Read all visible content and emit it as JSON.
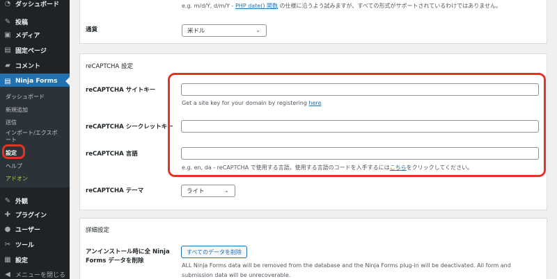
{
  "sidebar": {
    "items": [
      {
        "label": "ダッシュボード",
        "icon": "dashboard-icon",
        "glyph": "◔"
      },
      {
        "label": "投稿",
        "icon": "pin-icon",
        "glyph": "✎"
      },
      {
        "label": "メディア",
        "icon": "media-icon",
        "glyph": "▣"
      },
      {
        "label": "固定ページ",
        "icon": "page-icon",
        "glyph": "▤"
      },
      {
        "label": "コメント",
        "icon": "comment-icon",
        "glyph": "▰"
      },
      {
        "label": "Ninja Forms",
        "icon": "forms-icon",
        "glyph": "▤"
      },
      {
        "label": "外観",
        "icon": "appearance-icon",
        "glyph": "✎"
      },
      {
        "label": "プラグイン",
        "icon": "plugin-icon",
        "glyph": "✚"
      },
      {
        "label": "ユーザー",
        "icon": "user-icon",
        "glyph": "●"
      },
      {
        "label": "ツール",
        "icon": "tools-icon",
        "glyph": "✂"
      },
      {
        "label": "設定",
        "icon": "settings-icon",
        "glyph": "▦"
      },
      {
        "label": "メニューを閉じる",
        "icon": "collapse-icon",
        "glyph": "◀"
      }
    ],
    "submenu": [
      {
        "label": "ダッシュボード"
      },
      {
        "label": "新規追加"
      },
      {
        "label": "送信"
      },
      {
        "label": "インポート/エクスポ\nート"
      },
      {
        "label": "設定"
      },
      {
        "label": "ヘルプ"
      },
      {
        "label": "アドオン"
      }
    ]
  },
  "top_card": {
    "date_hint_pre": "e.g. m/d/Y, d/m/Y - ",
    "date_hint_link": "PHP date() 関数",
    "date_hint_post": " の仕様に沿うよう試みますが、すべての形式がサポートされているわけではありません。",
    "currency_label": "通貨",
    "currency_value": "米ドル"
  },
  "recaptcha": {
    "title": "reCAPTCHA 設定",
    "site_key_label": "reCAPTCHA サイトキー",
    "site_key_value": "",
    "site_key_hint_pre": "Get a site key for your domain by registering ",
    "site_key_hint_link": "here",
    "secret_key_label": "reCAPTCHA シークレットキー",
    "secret_key_value": "",
    "language_label": "reCAPTCHA 言語",
    "language_value": "",
    "language_hint_pre": "e.g. en, da - reCAPTCHA で使用する言語。使用する言語のコードを入手するには",
    "language_hint_link": "こちら",
    "language_hint_post": "をクリックしてください。",
    "theme_label": "reCAPTCHA テーマ",
    "theme_value": "ライト"
  },
  "advanced": {
    "title": "詳細設定",
    "uninstall_label": "アンインストール時に全 Ninja Forms データを削除",
    "delete_button": "すべてのデータを削除",
    "uninstall_desc_1": "ALL Ninja Forms data will be removed from the database and the Ninja Forms plug-in will be deactivated. All form and",
    "uninstall_desc_2": "submission data will be unrecoverable."
  },
  "colors": {
    "accent": "#2271b1",
    "highlight": "#e53222",
    "sidebar_bg": "#1d2327",
    "addon_green": "#a4d84a"
  }
}
